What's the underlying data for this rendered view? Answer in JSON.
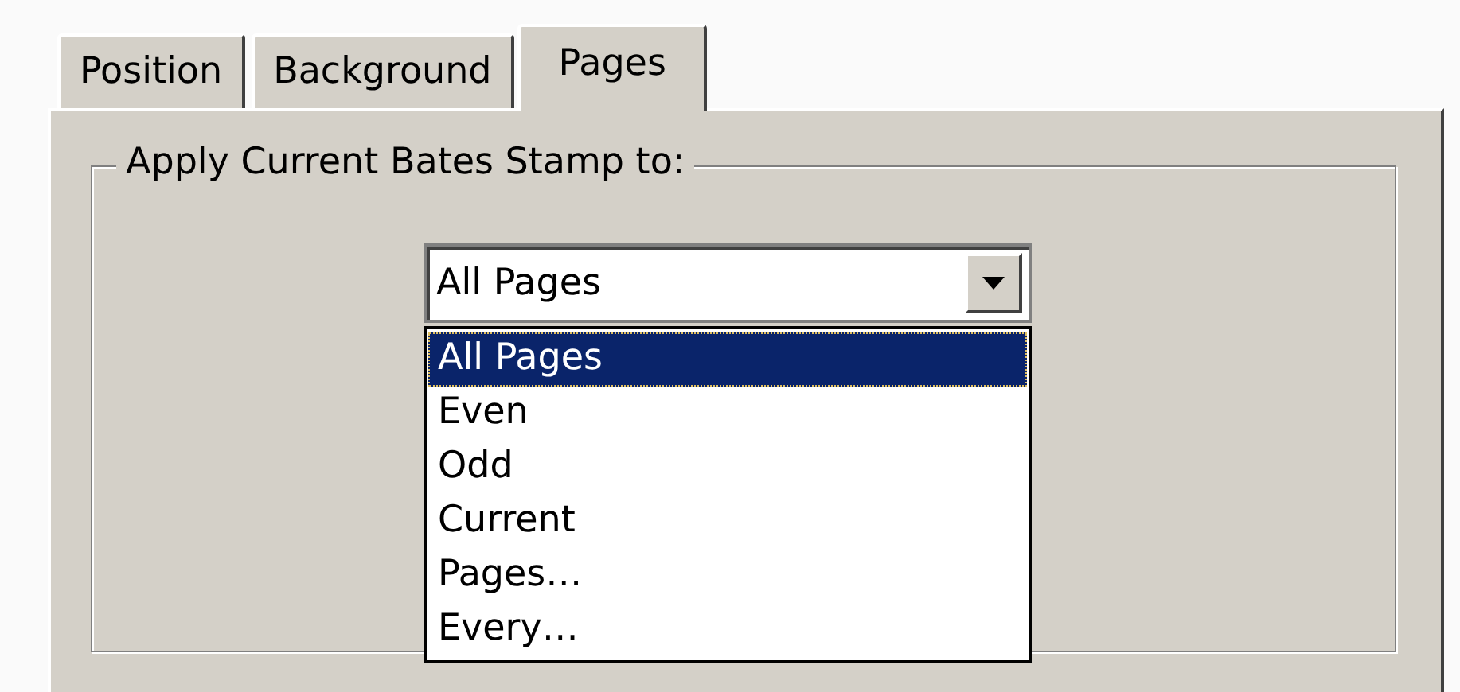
{
  "tabs": [
    {
      "label": "Position",
      "selected": false
    },
    {
      "label": "Background",
      "selected": false
    },
    {
      "label": "Pages",
      "selected": true
    }
  ],
  "group": {
    "title": "Apply Current Bates Stamp to:"
  },
  "combo": {
    "value": "All Pages",
    "expanded": true,
    "options": [
      {
        "label": "All Pages",
        "selected": true
      },
      {
        "label": "Even",
        "selected": false
      },
      {
        "label": "Odd",
        "selected": false
      },
      {
        "label": "Current",
        "selected": false
      },
      {
        "label": "Pages…",
        "selected": false
      },
      {
        "label": "Every…",
        "selected": false
      }
    ]
  }
}
